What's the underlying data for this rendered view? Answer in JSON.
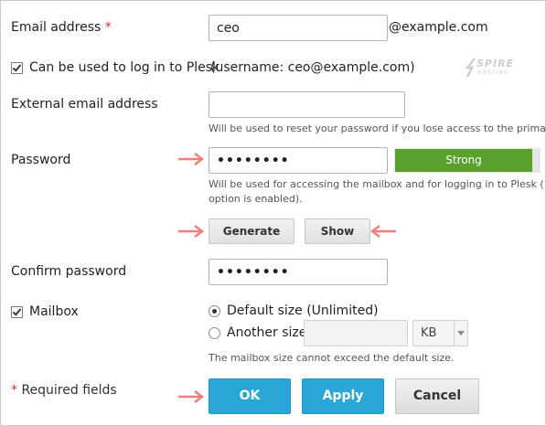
{
  "form": {
    "email_label": "Email address",
    "required_mark": "*",
    "email_value": "ceo",
    "email_domain": "@example.com",
    "login_checkbox_label": "Can be used to log in to Plesk",
    "login_username_note": "(username: ceo@example.com)",
    "external_email_label": "External email address",
    "external_email_value": "",
    "external_email_hint": "Will be used to reset your password if you lose access to the prima",
    "password_label": "Password",
    "password_value": "••••••••",
    "password_strength": "Strong",
    "password_hint_line1": "Will be used for accessing the mailbox and for logging in to Plesk (",
    "password_hint_line2": "option is enabled).",
    "generate_button": "Generate",
    "show_button": "Show",
    "confirm_password_label": "Confirm password",
    "confirm_password_value": "••••••••",
    "mailbox_label": "Mailbox",
    "mailbox_default_option": "Default size (Unlimited)",
    "mailbox_another_option": "Another size",
    "mailbox_size_value": "",
    "mailbox_unit": "KB",
    "mailbox_hint": "The mailbox size cannot exceed the default size.",
    "required_fields_note": "* Required fields",
    "ok_button": "OK",
    "apply_button": "Apply",
    "cancel_button": "Cancel"
  },
  "logo": {
    "line1": "SPIRE",
    "line2": "HOSTING"
  },
  "state": {
    "login_checkbox_checked": true,
    "mailbox_checkbox_checked": true,
    "mailbox_size_selection": "default",
    "password_strength_level": 0.95
  },
  "colors": {
    "accent_blue": "#2aa6d9",
    "strength_green": "#5aa02c",
    "annotation_arrow": "#f08080",
    "required_red": "#d9322a"
  },
  "icons": [
    "checkbox-checked-icon",
    "radio-selected-icon",
    "radio-unselected-icon",
    "dropdown-arrow-icon",
    "annotation-arrow-icon"
  ]
}
